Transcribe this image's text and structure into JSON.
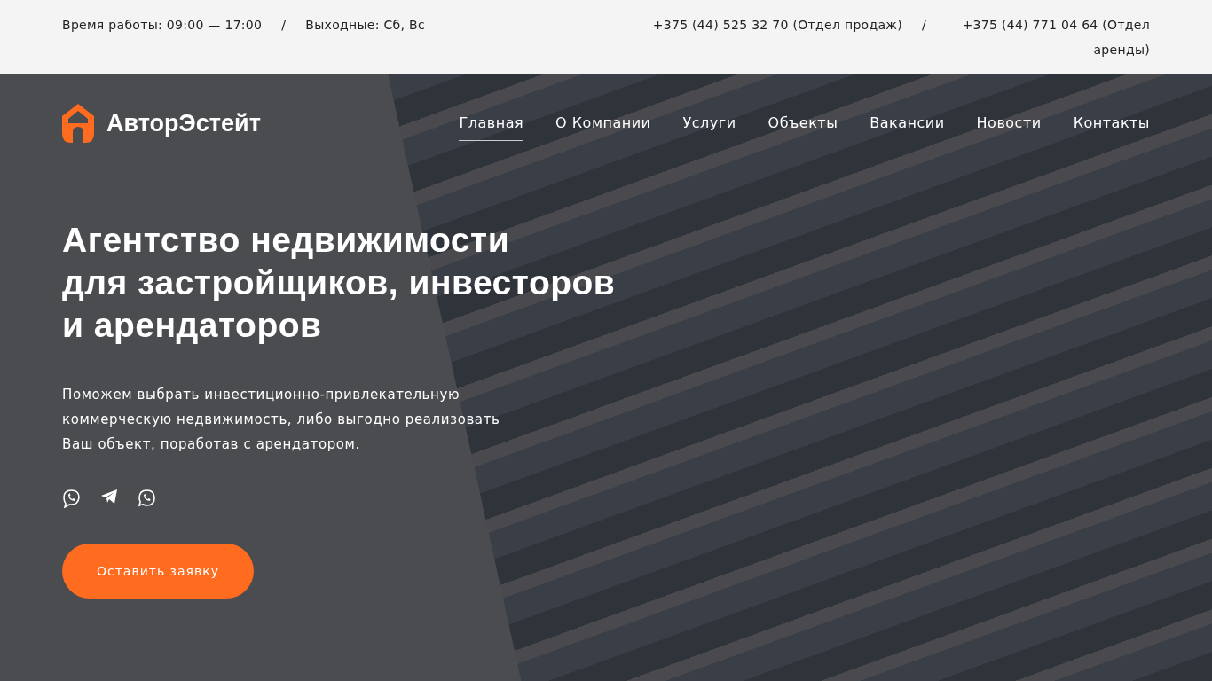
{
  "top_bar": {
    "hours": "Время работы: 09:00 — 17:00",
    "separator_left": "/",
    "weekend": "Выходные: Сб, Вс",
    "phones": [
      {
        "text": "+375 (44) 525 32 70 (Отдел продаж)"
      },
      {
        "text": "+375 (44) 771 04 64 (Отдел аренды)"
      }
    ],
    "separator_right": "/"
  },
  "logo": {
    "name": "АвторЭстейт"
  },
  "nav": [
    {
      "label": "Главная",
      "selected": true
    },
    {
      "label": "О Компании",
      "selected": false
    },
    {
      "label": "Услуги",
      "selected": false
    },
    {
      "label": "Объекты",
      "selected": false
    },
    {
      "label": "Вакансии",
      "selected": false
    },
    {
      "label": "Новости",
      "selected": false
    },
    {
      "label": "Контакты",
      "selected": false
    }
  ],
  "hero": {
    "title_lines": [
      "Агентство недвижимости",
      "для застройщиков, инвесторов",
      "и арендаторов"
    ],
    "description": "Поможем выбрать инвестиционно-привлекательную коммерческую недвижимость, либо выгодно реализовать Ваш объект, поработав с арендатором.",
    "socials": [
      {
        "kind": "viber"
      },
      {
        "kind": "telegram"
      },
      {
        "kind": "whatsapp"
      }
    ],
    "button": "Оставить заявку"
  }
}
